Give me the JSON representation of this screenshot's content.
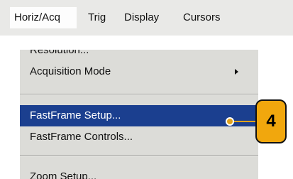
{
  "menubar": {
    "items": [
      {
        "label": "Horiz/Acq"
      },
      {
        "label": "Trig"
      },
      {
        "label": "Display"
      },
      {
        "label": "Cursors"
      }
    ]
  },
  "menu": {
    "items": [
      {
        "label": "Resolution..."
      },
      {
        "label": "Acquisition Mode",
        "submenu": true
      },
      {
        "label": "FastFrame Setup...",
        "selected": true
      },
      {
        "label": "FastFrame Controls..."
      },
      {
        "label": "Zoom Setup..."
      }
    ]
  },
  "callout": {
    "number": "4",
    "color": "#f1a70d"
  },
  "colors": {
    "highlight": "#1b3f8f",
    "menu_bg": "#dcdcd8"
  }
}
